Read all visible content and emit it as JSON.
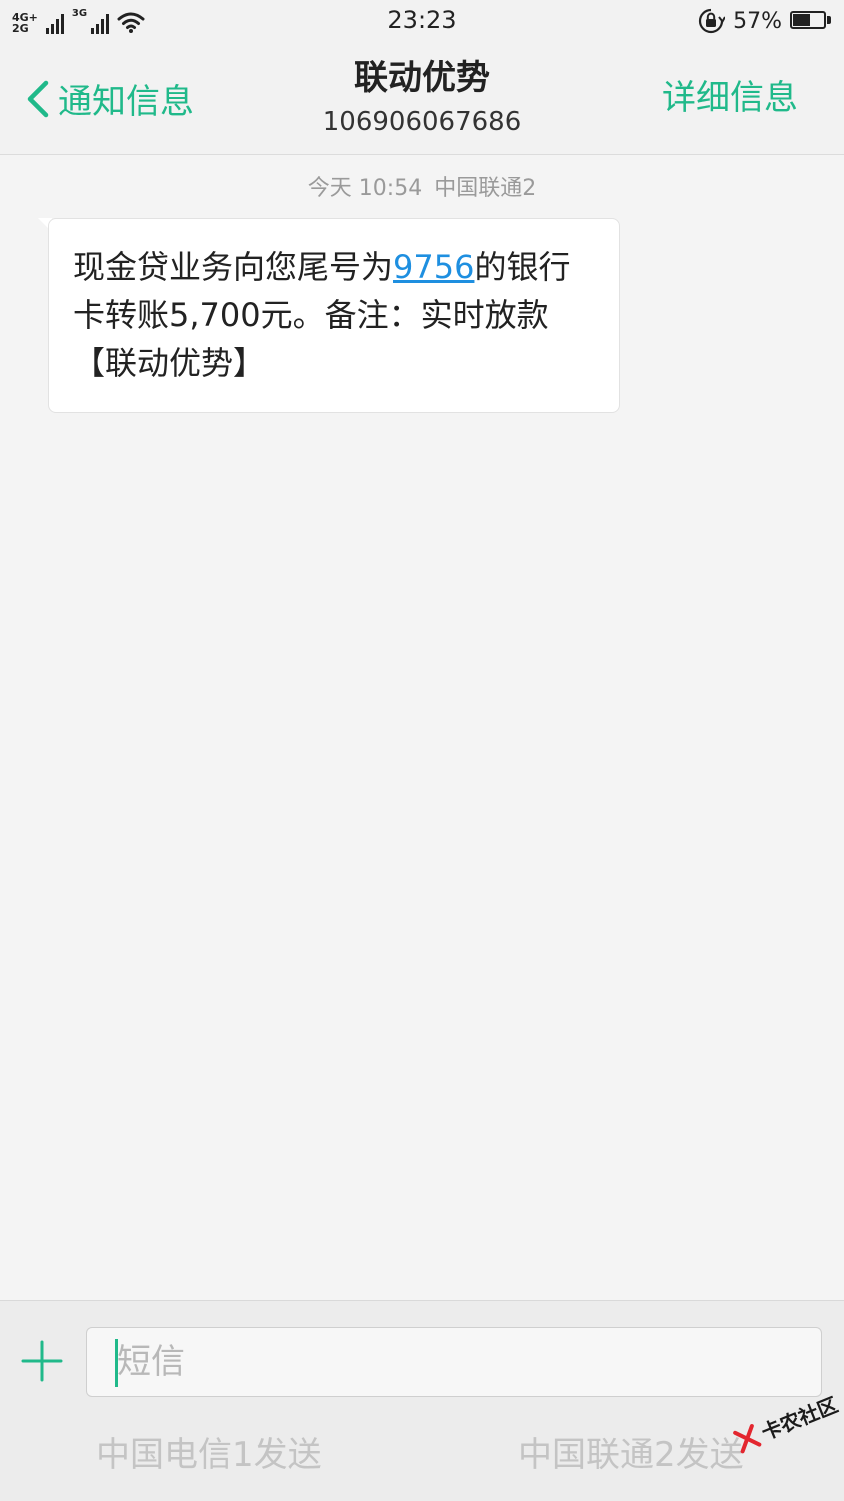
{
  "status_bar": {
    "net1_top": "4G+",
    "net1_bottom": "2G",
    "net2": "3G",
    "time": "23:23",
    "battery": "57%",
    "battery_level": 0.57
  },
  "header": {
    "back_label": "通知信息",
    "contact_name": "联动优势",
    "contact_number": "106906067686",
    "details_label": "详细信息",
    "accent_color": "#20b98a"
  },
  "messages": [
    {
      "date": "今天 10:54",
      "sim": "中国联通2",
      "text_before": "现金贷业务向您尾号为",
      "link_text": "9756",
      "text_after": "的银行卡转账5,700元。备注：实时放款【联动优势】"
    }
  ],
  "composer": {
    "placeholder": "短信",
    "value": "",
    "send_sim1": "中国电信1发送",
    "send_sim2": "中国联通2发送"
  },
  "watermark": {
    "text": "卡农社区"
  }
}
